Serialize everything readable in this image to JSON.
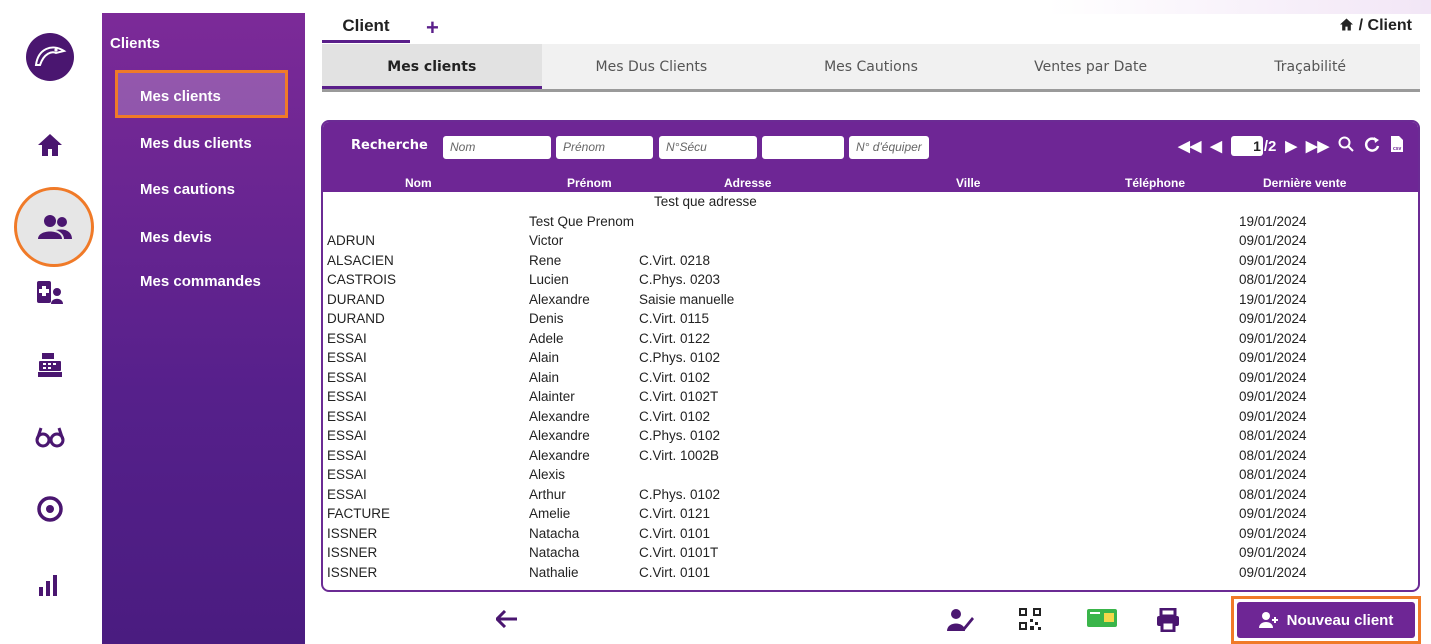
{
  "sidebar": {
    "title": "Clients",
    "items": [
      {
        "label": "Mes clients"
      },
      {
        "label": "Mes dus clients"
      },
      {
        "label": "Mes cautions"
      },
      {
        "label": "Mes devis"
      },
      {
        "label": "Mes commandes"
      }
    ]
  },
  "rail_icons": [
    "logo-icon",
    "home-icon",
    "clients-icon",
    "patient-add-icon",
    "cash-register-icon",
    "glasses-icon",
    "eye-icon",
    "stats-icon"
  ],
  "top": {
    "tab_label": "Client",
    "add_symbol": "+",
    "breadcrumb": "/ Client"
  },
  "subtabs": [
    "Mes clients",
    "Mes Dus Clients",
    "Mes Cautions",
    "Ventes par Date",
    "Traçabilité"
  ],
  "search": {
    "label": "Recherche",
    "placeholders": {
      "nom": "Nom",
      "prenom": "Prénom",
      "nsecu": "N°Sécu",
      "blank": "",
      "equip": "N° d'équiper"
    },
    "page_current": "1",
    "page_total": "/2"
  },
  "table": {
    "headers": [
      "Nom",
      "Prénom",
      "Adresse",
      "Ville",
      "Téléphone",
      "Dernière vente"
    ],
    "rows": [
      [
        "",
        "",
        "Test que adresse",
        "",
        "",
        ""
      ],
      [
        "",
        "Test Que Prenom",
        "",
        "",
        "",
        "19/01/2024"
      ],
      [
        "ADRUN",
        "Victor",
        "",
        "",
        "",
        "09/01/2024"
      ],
      [
        "ALSACIEN",
        "Rene",
        "C.Virt. 0218",
        "",
        "",
        "09/01/2024"
      ],
      [
        "CASTROIS",
        "Lucien",
        "C.Phys. 0203",
        "",
        "",
        "08/01/2024"
      ],
      [
        "DURAND",
        "Alexandre",
        "Saisie manuelle",
        "",
        "",
        "19/01/2024"
      ],
      [
        "DURAND",
        "Denis",
        "C.Virt. 0115",
        "",
        "",
        "09/01/2024"
      ],
      [
        "ESSAI",
        "Adele",
        "C.Virt. 0122",
        "",
        "",
        "09/01/2024"
      ],
      [
        "ESSAI",
        "Alain",
        "C.Phys. 0102",
        "",
        "",
        "09/01/2024"
      ],
      [
        "ESSAI",
        "Alain",
        "C.Virt. 0102",
        "",
        "",
        "09/01/2024"
      ],
      [
        "ESSAI",
        "Alainter",
        "C.Virt. 0102T",
        "",
        "",
        "09/01/2024"
      ],
      [
        "ESSAI",
        "Alexandre",
        "C.Virt. 0102",
        "",
        "",
        "09/01/2024"
      ],
      [
        "ESSAI",
        "Alexandre",
        "C.Phys. 0102",
        "",
        "",
        "08/01/2024"
      ],
      [
        "ESSAI",
        "Alexandre",
        "C.Virt. 1002B",
        "",
        "",
        "08/01/2024"
      ],
      [
        "ESSAI",
        "Alexis",
        "",
        "",
        "",
        "08/01/2024"
      ],
      [
        "ESSAI",
        "Arthur",
        "C.Phys. 0102",
        "",
        "",
        "08/01/2024"
      ],
      [
        "FACTURE",
        "Amelie",
        "C.Virt. 0121",
        "",
        "",
        "09/01/2024"
      ],
      [
        "ISSNER",
        "Natacha",
        "C.Virt. 0101",
        "",
        "",
        "09/01/2024"
      ],
      [
        "ISSNER",
        "Natacha",
        "C.Virt. 0101T",
        "",
        "",
        "09/01/2024"
      ],
      [
        "ISSNER",
        "Nathalie",
        "C.Virt. 0101",
        "",
        "",
        "09/01/2024"
      ]
    ]
  },
  "bottom": {
    "new_client_label": "Nouveau client"
  },
  "colors": {
    "brand": "#6e2695",
    "highlight": "#f07a28"
  }
}
